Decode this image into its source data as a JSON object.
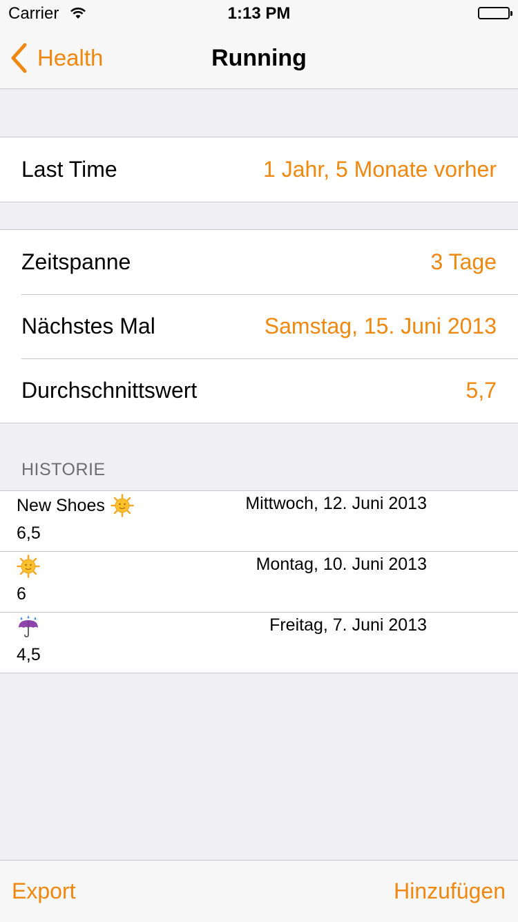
{
  "status_bar": {
    "carrier": "Carrier",
    "time": "1:13 PM"
  },
  "nav": {
    "back_label": "Health",
    "title": "Running"
  },
  "summary": {
    "last_time_label": "Last Time",
    "last_time_value": "1 Jahr, 5 Monate vorher"
  },
  "stats": {
    "period_label": "Zeitspanne",
    "period_value": "3 Tage",
    "next_label": "Nächstes Mal",
    "next_value": "Samstag, 15. Juni 2013",
    "avg_label": "Durchschnittswert",
    "avg_value": "5,7"
  },
  "history": {
    "header": "HISTORIE",
    "items": [
      {
        "name": "New Shoes",
        "icon": "sun-icon",
        "date": "Mittwoch, 12. Juni 2013",
        "value": "6,5"
      },
      {
        "name": "",
        "icon": "sun-icon",
        "date": "Montag, 10. Juni 2013",
        "value": "6"
      },
      {
        "name": "",
        "icon": "umbrella-rain-icon",
        "date": "Freitag, 7. Juni 2013",
        "value": "4,5"
      }
    ]
  },
  "toolbar": {
    "export_label": "Export",
    "add_label": "Hinzufügen"
  },
  "colors": {
    "accent": "#f0870e",
    "background": "#efeff4",
    "separator": "#c8c7cc"
  }
}
